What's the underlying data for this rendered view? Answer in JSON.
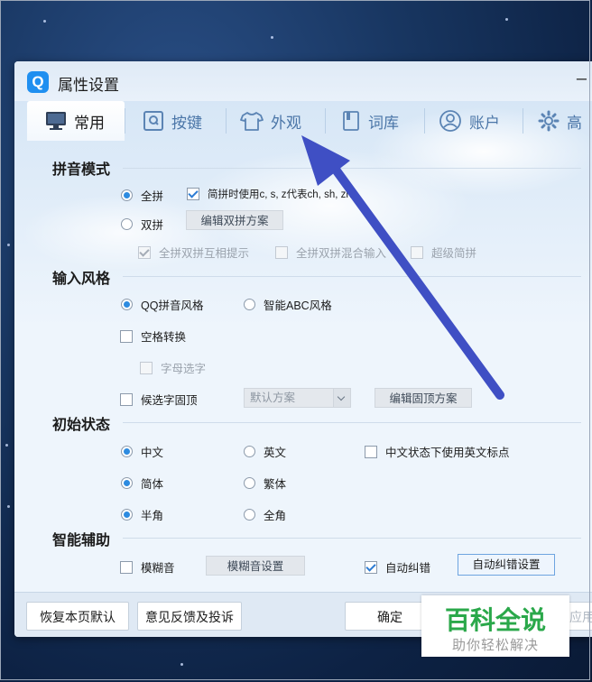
{
  "window": {
    "title": "属性设置",
    "logo_letter": "Q",
    "minimize_glyph": "–"
  },
  "tabs": [
    {
      "label": "常用",
      "icon": "monitor-icon",
      "active": true
    },
    {
      "label": "按键",
      "icon": "keyboard-key-icon",
      "active": false
    },
    {
      "label": "外观",
      "icon": "tshirt-icon",
      "active": false
    },
    {
      "label": "词库",
      "icon": "book-icon",
      "active": false
    },
    {
      "label": "账户",
      "icon": "user-icon",
      "active": false
    },
    {
      "label": "高",
      "icon": "gear-icon",
      "active": false
    }
  ],
  "sections": {
    "pinyin_mode": {
      "title": "拼音模式",
      "full_pinyin": {
        "label": "全拼",
        "selected": true
      },
      "jianpin_czs": {
        "label": "简拼时使用c, s, z代表ch, sh, zh",
        "checked": true
      },
      "double_pinyin": {
        "label": "双拼",
        "selected": false
      },
      "edit_double_button": "编辑双拼方案",
      "mutual_hint": {
        "label": "全拼双拼互相提示",
        "checked": true,
        "disabled": true
      },
      "mixed_input": {
        "label": "全拼双拼混合输入",
        "checked": false,
        "disabled": true
      },
      "super_jianpin": {
        "label": "超级简拼",
        "checked": false,
        "disabled": true
      }
    },
    "input_style": {
      "title": "输入风格",
      "qq_style": {
        "label": "QQ拼音风格",
        "selected": true
      },
      "abc_style": {
        "label": "智能ABC风格",
        "selected": false
      },
      "space_convert": {
        "label": "空格转换",
        "checked": false
      },
      "letter_select": {
        "label": "字母选字",
        "checked": false,
        "disabled": true
      },
      "fixed_top": {
        "label": "候选字固顶",
        "checked": false
      },
      "scheme_combo": "默认方案",
      "edit_top_button": "编辑固顶方案"
    },
    "initial_state": {
      "title": "初始状态",
      "chinese": {
        "label": "中文",
        "selected": true
      },
      "english": {
        "label": "英文",
        "selected": false
      },
      "cn_english_punct": {
        "label": "中文状态下使用英文标点",
        "checked": false
      },
      "simplified": {
        "label": "简体",
        "selected": true
      },
      "traditional": {
        "label": "繁体",
        "selected": false
      },
      "half_width": {
        "label": "半角",
        "selected": true
      },
      "full_width": {
        "label": "全角",
        "selected": false
      }
    },
    "smart_assist": {
      "title": "智能辅助",
      "fuzzy": {
        "label": "模糊音",
        "checked": false
      },
      "fuzzy_settings_button": "模糊音设置",
      "auto_correct": {
        "label": "自动纠错",
        "checked": true
      },
      "auto_correct_settings_button": "自动纠错设置"
    }
  },
  "bottom": {
    "restore_button": "恢复本页默认",
    "feedback_button": "意见反馈及投诉",
    "ok_button": "确定",
    "apply_button": "应用"
  },
  "watermark": {
    "title": "百科全说",
    "subtitle": "助你轻松解决"
  },
  "colors": {
    "accent": "#2d8be0",
    "arrow": "#3f4fc4",
    "watermark_green": "#2aa84a"
  }
}
